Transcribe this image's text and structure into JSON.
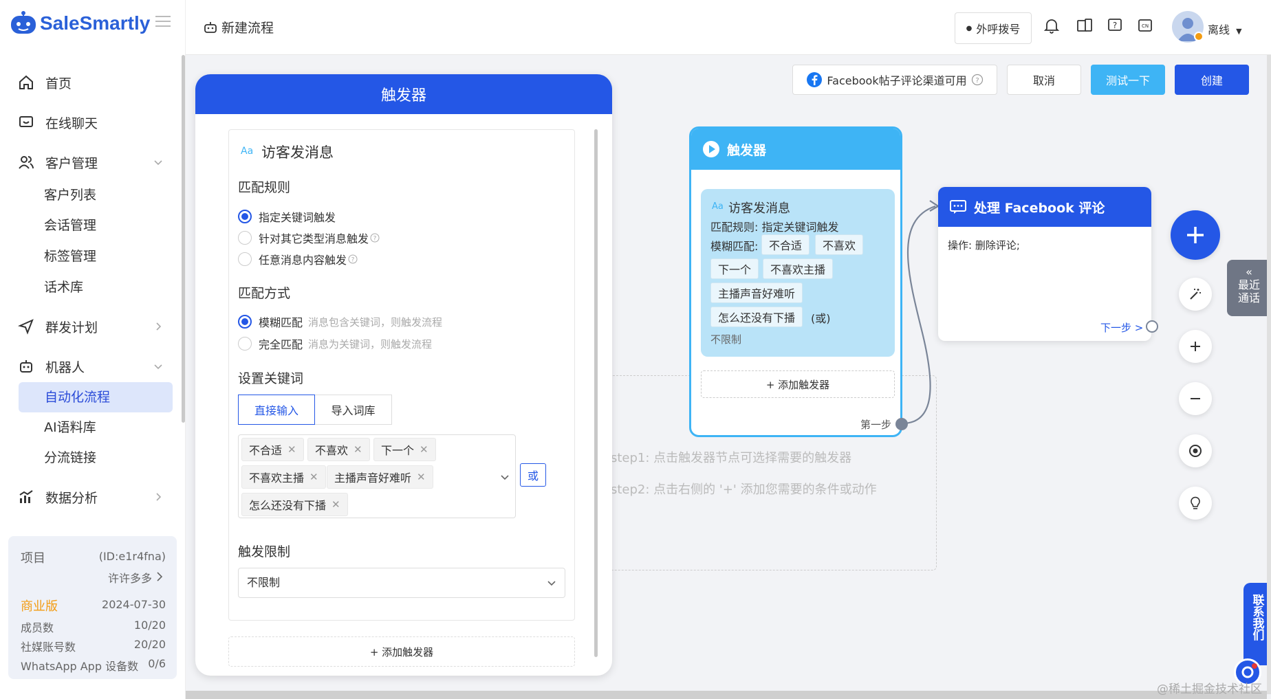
{
  "app": {
    "name": "SaleSmartly"
  },
  "sidebar": {
    "items": [
      {
        "label": "首页",
        "icon": "home-icon"
      },
      {
        "label": "在线聊天",
        "icon": "chat-icon"
      },
      {
        "label": "客户管理",
        "icon": "users-icon"
      },
      {
        "label": "群发计划",
        "icon": "send-icon"
      },
      {
        "label": "机器人",
        "icon": "robot-icon"
      },
      {
        "label": "数据分析",
        "icon": "analytics-icon"
      }
    ],
    "customer_sub": [
      "客户列表",
      "会话管理",
      "标签管理",
      "话术库"
    ],
    "robot_sub": [
      "自动化流程",
      "AI语料库",
      "分流链接"
    ],
    "active_sub": "自动化流程"
  },
  "project": {
    "label": "项目",
    "id": "(ID:e1r4fna)",
    "owner": "许许多多",
    "plan": "商业版",
    "expiry": "2024-07-30",
    "rows": [
      {
        "label": "成员数",
        "value": "10/20"
      },
      {
        "label": "社媒账号数",
        "value": "20/20"
      },
      {
        "label": "WhatsApp App 设备数",
        "value": "0/6"
      }
    ],
    "plan_color": "#f39c12"
  },
  "topbar": {
    "title": "新建流程",
    "outbound_call": "外呼拨号",
    "lang": "CN",
    "user_status": "离线"
  },
  "actions": {
    "fb_channel": "Facebook帖子评论渠道可用",
    "cancel": "取消",
    "test": "测试一下",
    "create": "创建"
  },
  "trigger_panel": {
    "title": "触发器",
    "event_prefix": "Aa",
    "event": "访客发消息",
    "match_rule_label": "匹配规则",
    "match_rules": [
      "指定关键词触发",
      "针对其它类型消息触发",
      "任意消息内容触发"
    ],
    "match_rule_selected": 0,
    "match_mode_label": "匹配方式",
    "match_modes": [
      {
        "label": "模糊匹配",
        "hint": "消息包含关键词，则触发流程"
      },
      {
        "label": "完全匹配",
        "hint": "消息为关键词，则触发流程"
      }
    ],
    "match_mode_selected": 0,
    "keywords_label": "设置关键词",
    "keyword_tabs": [
      "直接输入",
      "导入词库"
    ],
    "keywords": [
      "不合适",
      "不喜欢",
      "下一个",
      "不喜欢主播",
      "主播声音好难听",
      "怎么还没有下播"
    ],
    "or_button": "或",
    "limit_label": "触发限制",
    "limit_value": "不限制",
    "add_trigger": "+ 添加触发器"
  },
  "canvas": {
    "step1": "step1: 点击触发器节点可选择需要的触发器",
    "step2": "step2: 点击右侧的 '+' 添加您需要的条件或动作",
    "trigger_node": {
      "title": "触发器",
      "event_prefix": "Aa",
      "event": "访客发消息",
      "rule": "匹配规则: 指定关键词触发",
      "mode": "模糊匹配:",
      "keywords": [
        "不合适",
        "不喜欢",
        "下一个",
        "不喜欢主播",
        "主播声音好难听",
        "怎么还没有下播"
      ],
      "or_text": "(或)",
      "limit": "不限制",
      "add": "+ 添加触发器",
      "next": "第一步"
    },
    "action_node": {
      "title": "处理 Facebook 评论",
      "op": "操作: 删除评论;",
      "next": "下一步 >"
    },
    "recent_calls": [
      "最近",
      "通话"
    ],
    "contact_us": "联系我们"
  },
  "watermark": "@稀土掘金技术社区"
}
